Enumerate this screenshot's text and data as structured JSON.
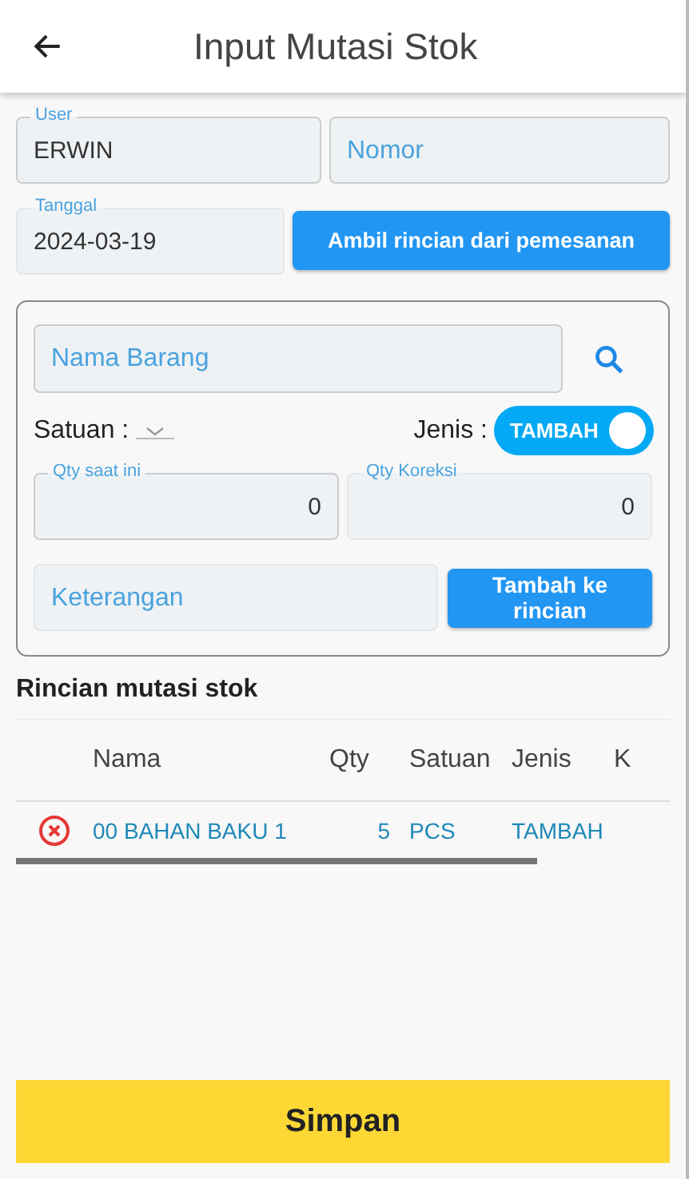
{
  "header": {
    "title": "Input Mutasi Stok"
  },
  "user_field": {
    "label": "User",
    "value": "ERWIN"
  },
  "nomor_field": {
    "placeholder": "Nomor"
  },
  "tanggal_field": {
    "label": "Tanggal",
    "value": "2024-03-19"
  },
  "ambil_button": "Ambil rincian dari pemesanan",
  "item_form": {
    "nama_barang": {
      "placeholder": "Nama Barang"
    },
    "satuan_label": "Satuan :",
    "jenis_label": "Jenis :",
    "jenis_toggle": {
      "label": "TAMBAH",
      "on": true
    },
    "qty_saat_ini": {
      "label": "Qty saat ini",
      "value": "0"
    },
    "qty_koreksi": {
      "label": "Qty Koreksi",
      "value": "0"
    },
    "keterangan": {
      "placeholder": "Keterangan"
    },
    "add_button": "Tambah ke rincian"
  },
  "section_title": "Rincian mutasi stok",
  "table": {
    "columns": [
      "Nama",
      "Qty",
      "Satuan",
      "Jenis",
      "K"
    ],
    "rows": [
      {
        "nama": "00 BAHAN BAKU 1",
        "qty": "5",
        "satuan": "PCS",
        "jenis": "TAMBAH"
      }
    ]
  },
  "save_button": "Simpan"
}
